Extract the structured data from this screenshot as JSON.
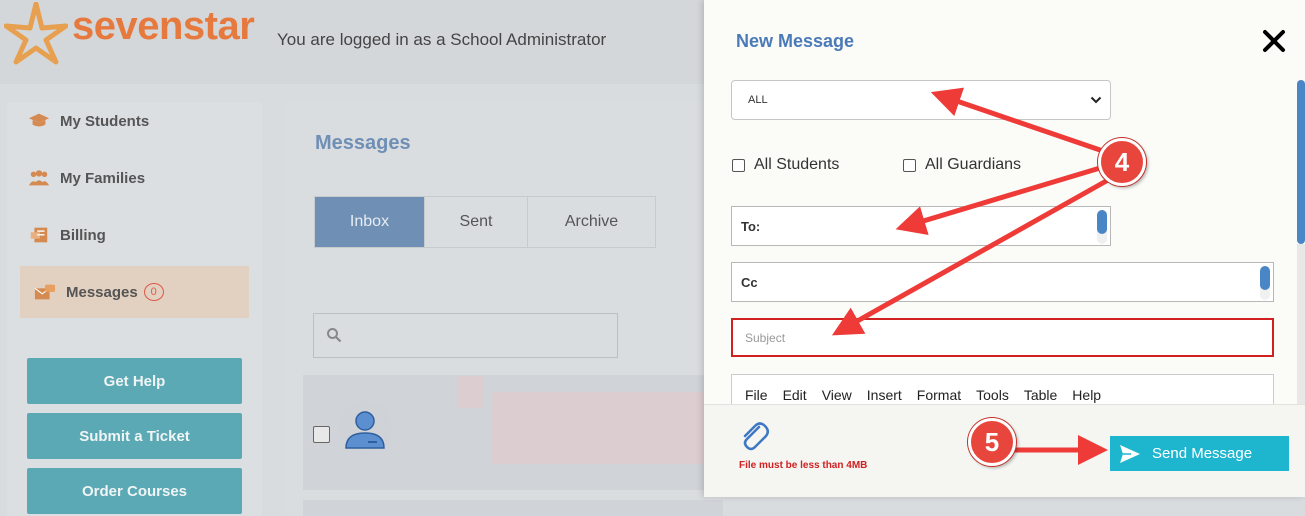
{
  "brand": {
    "name": "sevenstar",
    "accent": "#e67a3e"
  },
  "header": {
    "logged_in_text": "You are logged in as a School Administrator"
  },
  "sidebar": {
    "items": [
      {
        "label": "My Students",
        "icon": "graduation-cap-icon"
      },
      {
        "label": "My Families",
        "icon": "users-icon"
      },
      {
        "label": "Billing",
        "icon": "billing-icon"
      },
      {
        "label": "Messages",
        "icon": "messages-icon",
        "badge": "0",
        "active": true
      }
    ],
    "buttons": [
      {
        "label": "Get Help"
      },
      {
        "label": "Submit a Ticket"
      },
      {
        "label": "Order Courses"
      }
    ]
  },
  "main": {
    "title": "Messages",
    "tabs": [
      {
        "label": "Inbox",
        "active": true
      },
      {
        "label": "Sent"
      },
      {
        "label": "Archive"
      }
    ],
    "search_placeholder": ""
  },
  "modal": {
    "title": "New Message",
    "recipient_select": {
      "value": "ALL"
    },
    "checkboxes": [
      {
        "label": "All Students",
        "checked": false
      },
      {
        "label": "All Guardians",
        "checked": false
      }
    ],
    "to_label": "To:",
    "cc_label": "Cc",
    "subject_placeholder": "Subject",
    "editor_menu": [
      "File",
      "Edit",
      "View",
      "Insert",
      "Format",
      "Tools",
      "Table",
      "Help"
    ],
    "file_note": "File must be less than 4MB",
    "send_label": "Send Message"
  },
  "annotations": [
    {
      "label": "4"
    },
    {
      "label": "5"
    }
  ],
  "colors": {
    "modal_title": "#4a7ab8",
    "send_button": "#1eb6cf",
    "error_red": "#d02020",
    "annotation_red": "#e8463c"
  }
}
